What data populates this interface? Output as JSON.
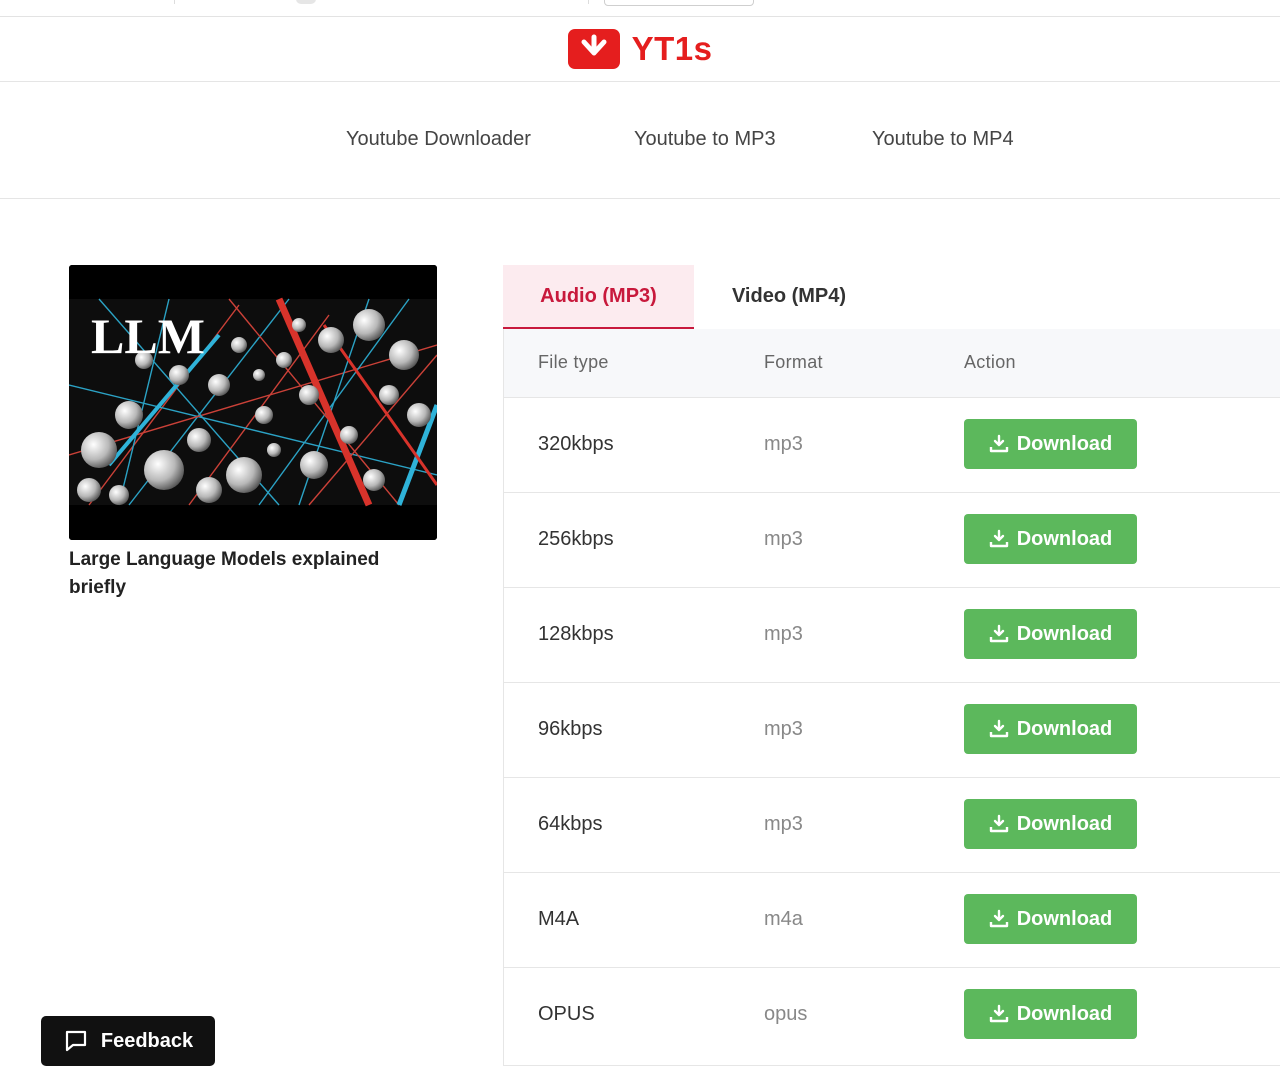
{
  "brand": {
    "name": "YT1s",
    "color": "#e51e1e",
    "icon": "download-arrow-icon"
  },
  "nav": [
    {
      "label": "Youtube Downloader"
    },
    {
      "label": "Youtube to MP3"
    },
    {
      "label": "Youtube to MP4"
    }
  ],
  "video": {
    "thumbnail_text": "LLM",
    "title": "Large Language Models explained briefly"
  },
  "tabs": [
    {
      "label": "Audio (MP3)",
      "active": true
    },
    {
      "label": "Video (MP4)",
      "active": false
    }
  ],
  "table": {
    "columns": [
      "File type",
      "Format",
      "Action"
    ],
    "rows": [
      {
        "file_type": "320kbps",
        "format": "mp3",
        "action": "Download"
      },
      {
        "file_type": "256kbps",
        "format": "mp3",
        "action": "Download"
      },
      {
        "file_type": "128kbps",
        "format": "mp3",
        "action": "Download"
      },
      {
        "file_type": "96kbps",
        "format": "mp3",
        "action": "Download"
      },
      {
        "file_type": "64kbps",
        "format": "mp3",
        "action": "Download"
      },
      {
        "file_type": "M4A",
        "format": "m4a",
        "action": "Download"
      },
      {
        "file_type": "OPUS",
        "format": "opus",
        "action": "Download"
      }
    ]
  },
  "feedback": {
    "label": "Feedback",
    "icon": "chat-bubble-icon"
  },
  "colors": {
    "accent": "#c8193c",
    "download_green": "#5cb85c"
  }
}
